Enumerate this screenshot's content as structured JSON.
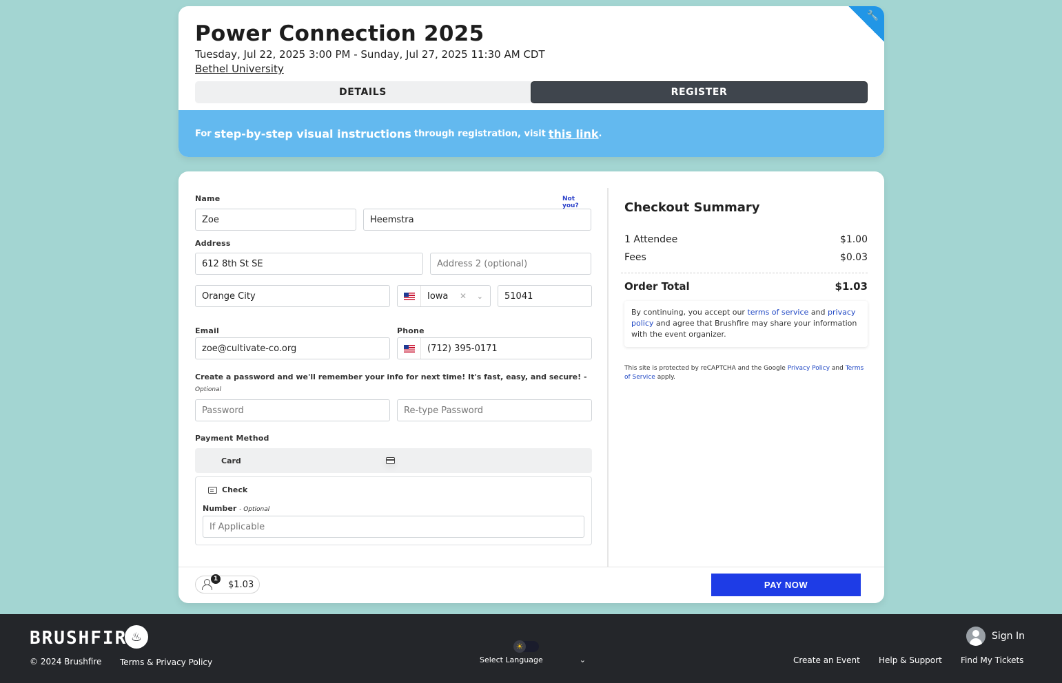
{
  "event": {
    "title": "Power Connection 2025",
    "dates": "Tuesday, Jul 22, 2025 3:00 PM - Sunday, Jul 27, 2025 11:30 AM CDT",
    "venue": "Bethel University"
  },
  "tabs": [
    {
      "label": "DETAILS",
      "active": false
    },
    {
      "label": "REGISTER",
      "active": true
    }
  ],
  "banner": {
    "prefix": "For",
    "emphasis": "step-by-step visual instructions",
    "middle": "through registration, visit",
    "link": "this link",
    "suffix": "."
  },
  "form": {
    "name_label": "Name",
    "not_you": "Not you?",
    "first_name": "Zoe",
    "last_name": "Heemstra",
    "address_label": "Address",
    "address1": "612 8th St SE",
    "address2_placeholder": "Address 2 (optional)",
    "city": "Orange City",
    "state": "Iowa",
    "zip": "51041",
    "email_label": "Email",
    "email": "zoe@cultivate-co.org",
    "phone_label": "Phone",
    "phone": "(712) 395-0171",
    "password_note": "Create a password and we'll remember your info for next time! It's fast, easy, and secure!",
    "password_note_opt_sep": " -",
    "password_note_opt": "Optional",
    "password_placeholder": "Password",
    "retype_placeholder": "Re-type Password",
    "payment_label": "Payment Method",
    "pay_card": "Card",
    "pay_check": "Check",
    "check_number_label": "Number",
    "check_number_opt": "- Optional",
    "check_number_placeholder": "If Applicable"
  },
  "summary": {
    "title": "Checkout Summary",
    "rows": [
      {
        "label": "1 Attendee",
        "value": "$1.00"
      },
      {
        "label": "Fees",
        "value": "$0.03"
      }
    ],
    "total_label": "Order Total",
    "total_value": "$1.03",
    "terms_pre": "By continuing, you accept our",
    "terms_link": "terms of service",
    "terms_and": "and",
    "privacy_link": "privacy policy",
    "terms_post": "and agree that Brushfire may share your information with the event organizer.",
    "recaptcha_pre": "This site is protected by reCAPTCHA and the Google",
    "recaptcha_privacy": "Privacy Policy",
    "recaptcha_and": "and",
    "recaptcha_terms": "Terms of Service",
    "recaptcha_post": "apply."
  },
  "bottom_bar": {
    "attendee_count": "1",
    "cart_total": "$1.03",
    "pay_now": "PAY NOW"
  },
  "footer": {
    "logo": "BRUSHFIRE",
    "copyright": "© 2024 Brushfire",
    "terms": "Terms & Privacy Policy",
    "language": "Select Language",
    "sign_in": "Sign In",
    "links": [
      "Create an Event",
      "Help & Support",
      "Find My Tickets"
    ]
  },
  "colors": {
    "background": "#a3d5d2",
    "banner": "#63b9ef",
    "accent": "#1e3ce6",
    "tab_active": "#3f454d",
    "footer": "#24262a"
  },
  "icons": {
    "corner": "wrench-icon",
    "card": "credit-card-icon",
    "check": "check-icon",
    "people": "people-icon",
    "flame": "flame-icon",
    "theme": "sun-icon",
    "user": "user-avatar-icon"
  }
}
